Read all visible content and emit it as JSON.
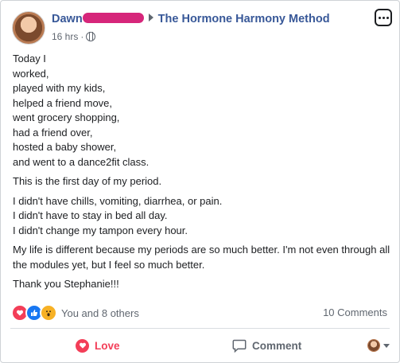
{
  "post": {
    "author": "Dawn",
    "group": "The Hormone Harmony Method",
    "time": "16 hrs",
    "separator": "·",
    "paragraphs": [
      [
        "Today I",
        "worked,",
        "played with my kids,",
        "helped a friend move,",
        "went grocery shopping,",
        "had a friend over,",
        "hosted a baby shower,",
        "and went to a dance2fit class."
      ],
      [
        "This is the first day of my period."
      ],
      [
        "I didn't have chills, vomiting, diarrhea, or pain.",
        "I didn't have to stay in bed all day.",
        "I didn't change my tampon every hour."
      ],
      [
        "My life is different because my periods are so much better. I'm not even through all the modules yet, but I feel so much better."
      ],
      [
        "Thank you Stephanie!!!"
      ]
    ]
  },
  "reactions": {
    "icons": [
      "love-icon",
      "like-icon",
      "wow-icon"
    ],
    "summary": "You and 8 others",
    "comments": "10 Comments"
  },
  "actions": {
    "love_label": "Love",
    "comment_label": "Comment"
  },
  "colors": {
    "link": "#385898",
    "love": "#f33e58",
    "like": "#1877f2",
    "wow": "#f7b125",
    "redaction": "#d6267a"
  }
}
